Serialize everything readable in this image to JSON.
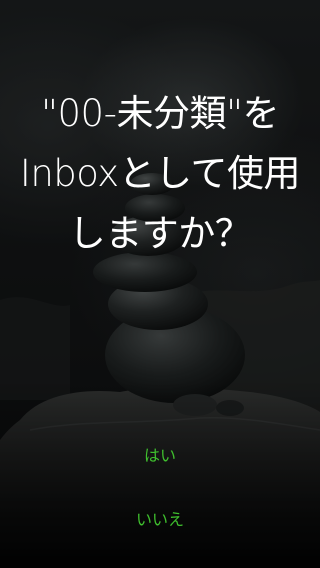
{
  "dialog": {
    "title_lines": [
      "\"00-未分類\"を",
      "Inboxとして使用",
      "しますか？"
    ],
    "yes_label": "はい",
    "no_label": "いいえ"
  },
  "background": {
    "image": "stacked-stones-photo"
  },
  "colors": {
    "text": "#ffffff",
    "accent": "#3fbf2e"
  }
}
